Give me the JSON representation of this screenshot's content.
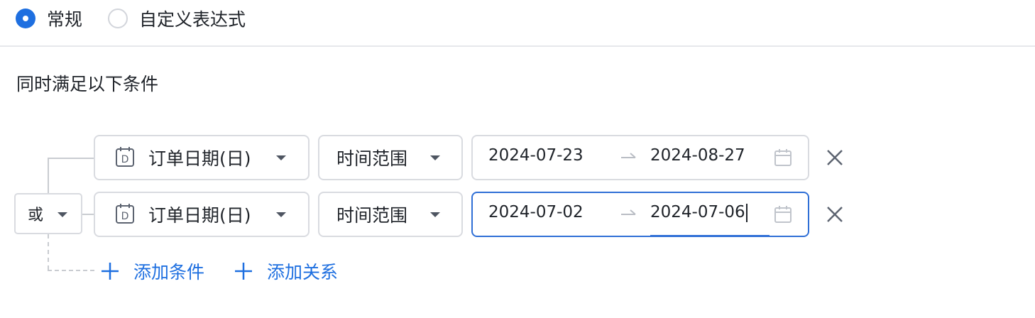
{
  "mode": {
    "options": [
      {
        "label": "常规",
        "checked": true
      },
      {
        "label": "自定义表达式",
        "checked": false
      }
    ]
  },
  "section": {
    "title": "同时满足以下条件"
  },
  "relation": {
    "label": "或"
  },
  "conditions": [
    {
      "field": "订单日期(日)",
      "field_icon": "date-D-icon",
      "operator": "时间范围",
      "start": "2024-07-23",
      "end": "2024-08-27"
    },
    {
      "field": "订单日期(日)",
      "field_icon": "date-D-icon",
      "operator": "时间范围",
      "start": "2024-07-02",
      "end": "2024-07-06",
      "focused": true
    }
  ],
  "actions": {
    "add_condition": "添加条件",
    "add_relation": "添加关系"
  },
  "colors": {
    "accent": "#1e6fe0",
    "border": "#d9dbe0",
    "focus_border": "#2f6fd6",
    "text": "#1f2329"
  }
}
